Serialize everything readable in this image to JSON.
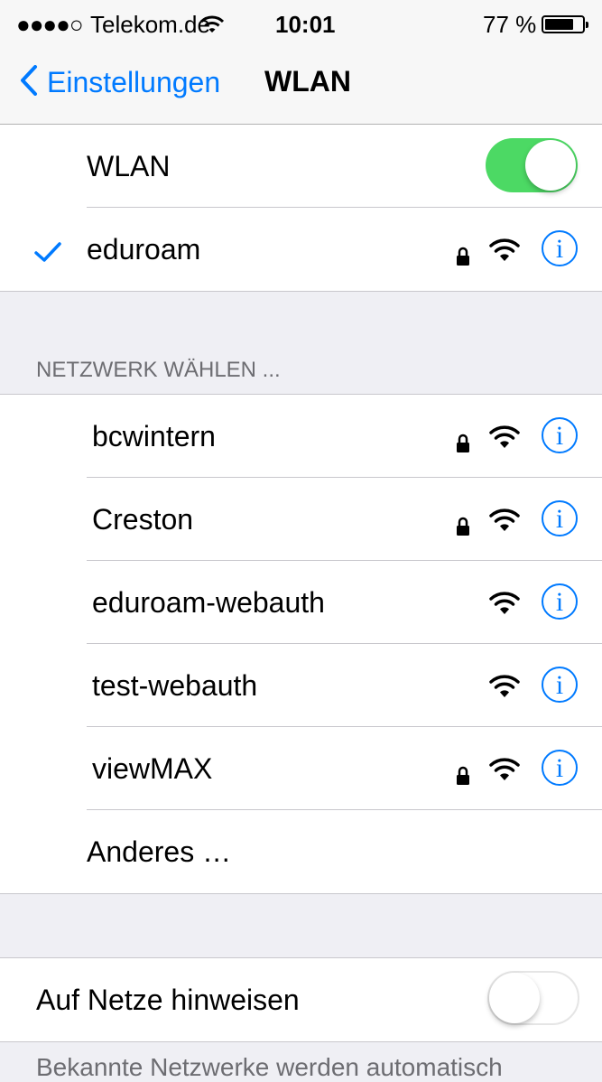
{
  "status_bar": {
    "signal": "●●●●○",
    "carrier": "Telekom.de",
    "time": "10:01",
    "battery_percent": "77 %",
    "battery_level": 0.77
  },
  "nav": {
    "back_label": "Einstellungen",
    "title": "WLAN"
  },
  "wlan": {
    "label": "WLAN",
    "enabled": true
  },
  "connected": {
    "name": "eduroam",
    "secured": true
  },
  "section_header": "NETZWERK WÄHLEN ...",
  "networks": [
    {
      "name": "bcwintern",
      "secured": true
    },
    {
      "name": "Creston",
      "secured": true
    },
    {
      "name": "eduroam-webauth",
      "secured": false
    },
    {
      "name": "test-webauth",
      "secured": false
    },
    {
      "name": "viewMAX",
      "secured": true
    }
  ],
  "other_label": "Anderes …",
  "ask_to_join": {
    "label": "Auf Netze hinweisen",
    "enabled": false
  },
  "footer_text": "Bekannte Netzwerke werden automatisch",
  "colors": {
    "accent": "#007aff",
    "toggle_on": "#4cd964",
    "background": "#efeff4"
  },
  "icons": {
    "check": "checkmark-icon",
    "lock": "lock-icon",
    "wifi": "wifi-signal-icon",
    "info": "info-icon"
  },
  "info_glyph": "i"
}
